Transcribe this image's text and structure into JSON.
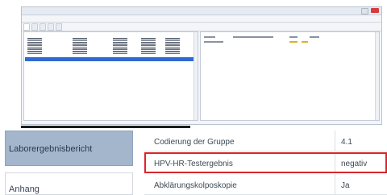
{
  "mini_screenshot": {
    "title": "",
    "colors": {
      "selection": "#2f6ad3",
      "close_button": "#d83b3b"
    }
  },
  "nav": {
    "items": [
      {
        "label": "Laborergebnisbericht",
        "active": true
      },
      {
        "label": "Anhang",
        "active": false
      }
    ]
  },
  "table": {
    "rows": [
      {
        "label": "Codierung der Gruppe",
        "value": "4.1",
        "highlighted": false
      },
      {
        "label": "HPV-HR-Testergebnis",
        "value": "negativ",
        "highlighted": true
      },
      {
        "label": "Abklärungskolposkopie",
        "value": "Ja",
        "highlighted": false
      }
    ]
  },
  "colors": {
    "highlight_border": "#d9262a",
    "nav_active_bg": "#a4b6cc"
  }
}
